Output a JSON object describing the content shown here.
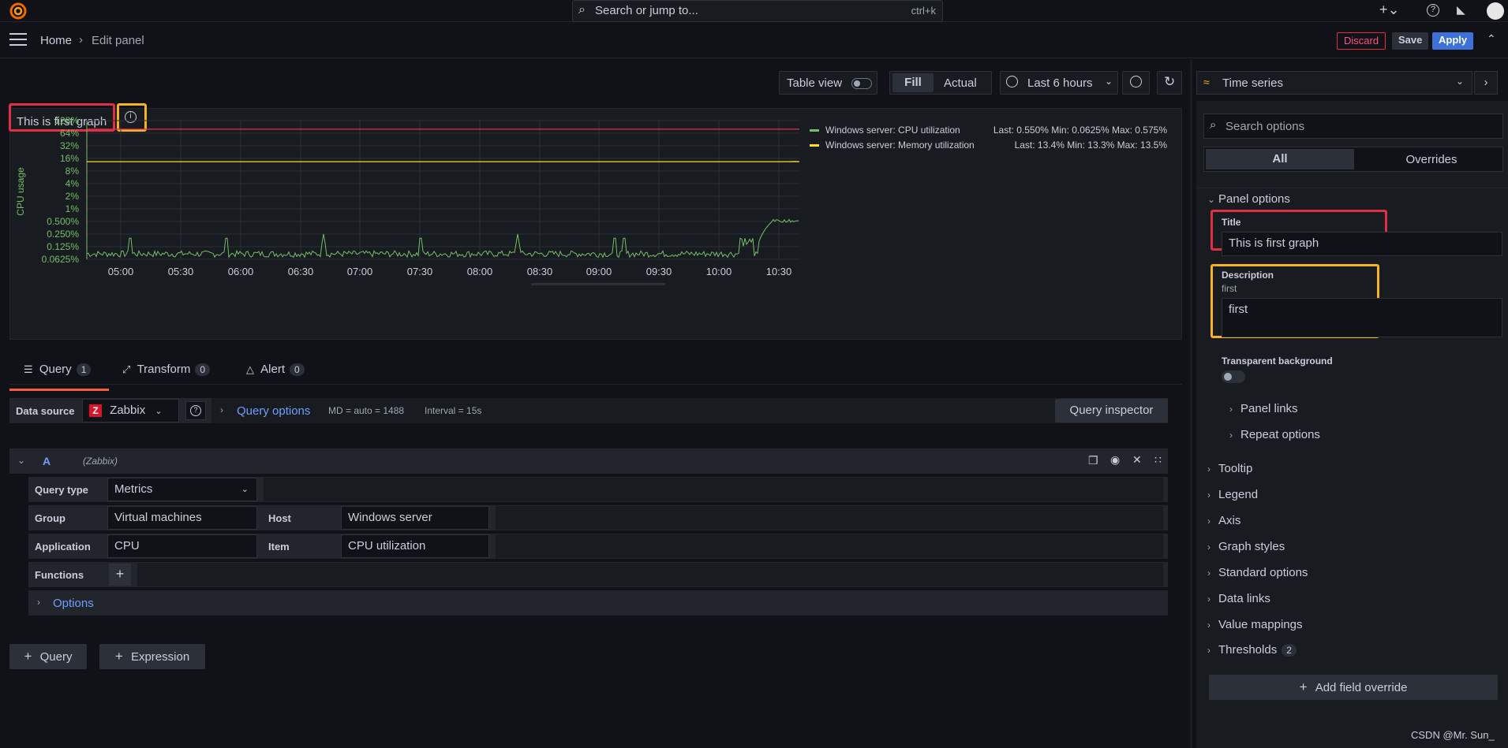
{
  "topbar": {
    "search_placeholder": "Search or jump to...",
    "shortcut": "ctrl+k"
  },
  "breadcrumb": {
    "home": "Home",
    "current": "Edit panel"
  },
  "header_buttons": {
    "discard": "Discard",
    "save": "Save",
    "apply": "Apply"
  },
  "toolbar": {
    "table_view": "Table view",
    "fill": "Fill",
    "actual": "Actual",
    "time_range": "Last 6 hours"
  },
  "viz": {
    "type": "Time series"
  },
  "panel": {
    "title": "This is first graph",
    "ylabel": "CPU usage"
  },
  "chart_data": {
    "type": "line",
    "yaxis_label": "CPU usage",
    "yscale": "log2",
    "yticks": [
      "128%",
      "64%",
      "32%",
      "16%",
      "8%",
      "4%",
      "2%",
      "1%",
      "0.500%",
      "0.250%",
      "0.125%",
      "0.0625%"
    ],
    "xticks": [
      "05:00",
      "05:30",
      "06:00",
      "06:30",
      "07:00",
      "07:30",
      "08:00",
      "08:30",
      "09:00",
      "09:30",
      "10:00",
      "10:30"
    ],
    "series": [
      {
        "name": "Windows server: CPU utilization",
        "color": "#73bf69",
        "last": "0.550%",
        "min": "0.0625%",
        "max": "0.575%"
      },
      {
        "name": "Windows server: Memory utilization",
        "color": "#fade2a",
        "last": "13.4%",
        "min": "13.3%",
        "max": "13.5%"
      }
    ],
    "threshold_color": "#e02f44"
  },
  "query_tabs": [
    {
      "label": "Query",
      "count": "1"
    },
    {
      "label": "Transform",
      "count": "0"
    },
    {
      "label": "Alert",
      "count": "0"
    }
  ],
  "datasource": {
    "label": "Data source",
    "value": "Zabbix",
    "query_options": "Query options",
    "md": "MD = auto = 1488",
    "interval": "Interval = 15s",
    "inspector": "Query inspector"
  },
  "query": {
    "ref": "A",
    "ds": "(Zabbix)",
    "query_type_label": "Query type",
    "query_type": "Metrics",
    "group_label": "Group",
    "group": "Virtual machines",
    "host_label": "Host",
    "host": "Windows server",
    "application_label": "Application",
    "application": "CPU",
    "item_label": "Item",
    "item": "CPU utilization",
    "functions_label": "Functions",
    "options": "Options"
  },
  "add": {
    "query": "Query",
    "expression": "Expression"
  },
  "options_pane": {
    "search_placeholder": "Search options",
    "tab_all": "All",
    "tab_overrides": "Overrides",
    "panel_options": "Panel options",
    "title_label": "Title",
    "title_value": "This is first graph",
    "description_label": "Description",
    "description_hint": "first",
    "description_value": "first",
    "transparent_label": "Transparent background",
    "panel_links": "Panel links",
    "repeat_options": "Repeat options",
    "sections": [
      "Tooltip",
      "Legend",
      "Axis",
      "Graph styles",
      "Standard options",
      "Data links",
      "Value mappings"
    ],
    "thresholds": "Thresholds",
    "thresholds_count": "2",
    "add_override": "Add field override"
  },
  "watermark": "CSDN @Mr. Sun_"
}
